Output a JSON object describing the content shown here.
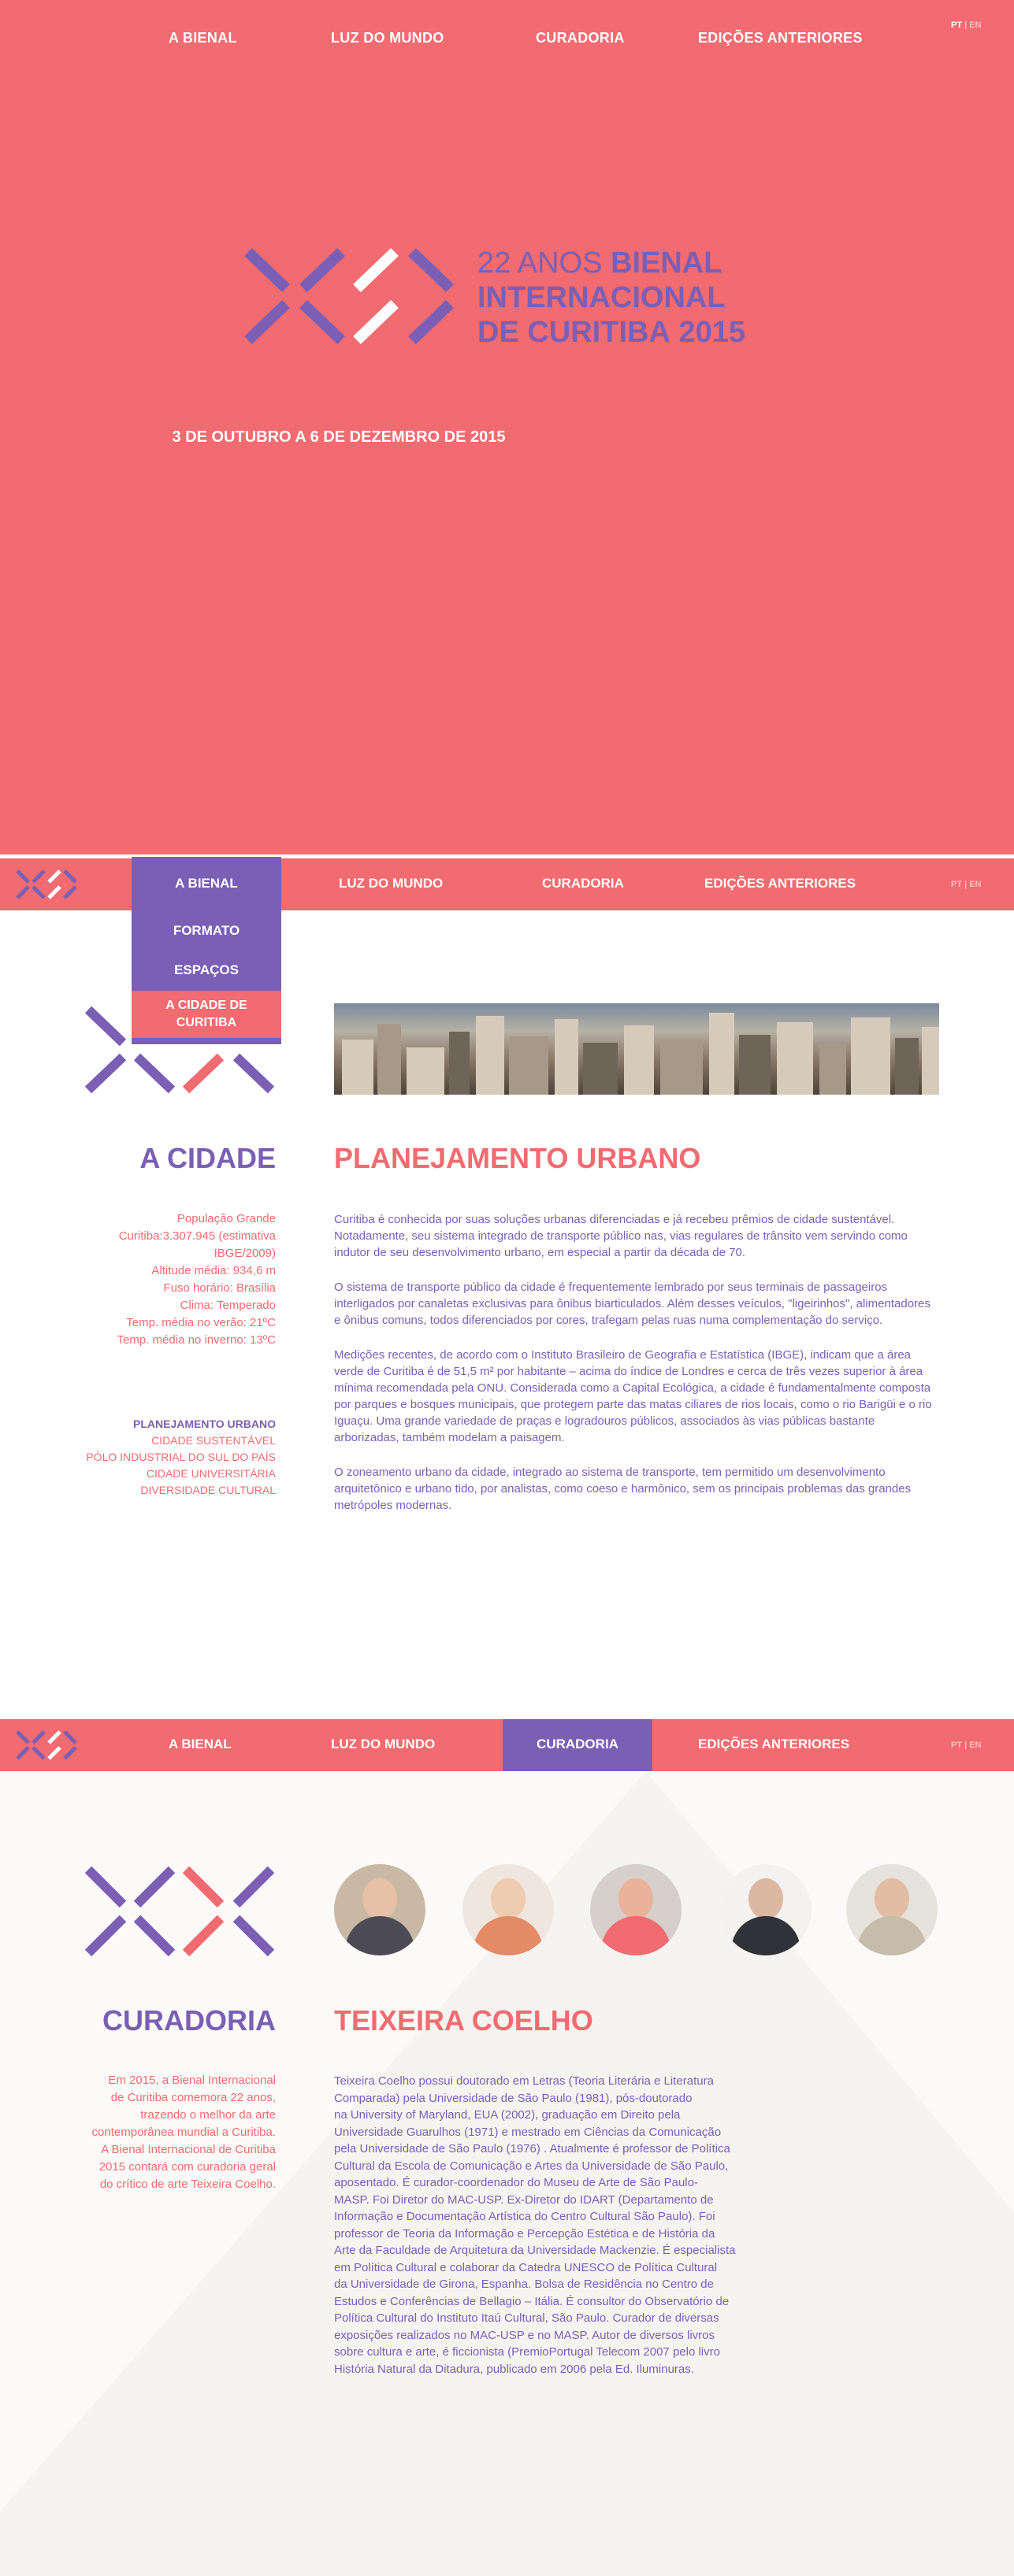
{
  "colors": {
    "coral": "#f16b70",
    "purple": "#7a5fb4",
    "white": "#ffffff"
  },
  "nav": {
    "items": [
      "A BIENAL",
      "LUZ DO MUNDO",
      "CURADORIA",
      "EDIÇÕES ANTERIORES"
    ],
    "lang_pt": "PT",
    "lang_sep": "|",
    "lang_en": "EN"
  },
  "hero": {
    "title_line1_light": "22 ANOS",
    "title_line1_bold": "BIENAL",
    "title_line2": "INTERNACIONAL",
    "title_line3_light": "DE CURITIBA",
    "title_line3_bold": "2015",
    "date": "3 DE OUTUBRO A 6 DE DEZEMBRO DE 2015"
  },
  "section_city": {
    "dropdown": [
      "FORMATO",
      "ESPAÇOS",
      "A CIDADE DE CURITIBA"
    ],
    "dropdown_active_line1": "A CIDADE DE",
    "dropdown_active_line2": "CURITIBA",
    "left_title": "A CIDADE",
    "facts": [
      "População Grande",
      "Curitiba:3.307.945 (estimativa",
      "IBGE/2009)",
      "Altitude média: 934,6 m",
      "Fuso horário: Brasília",
      "Clima: Temperado",
      "Temp. média no verão: 21ºC",
      "Temp. média no inverno: 13ºC"
    ],
    "subnav_title": "PLANEJAMENTO URBANO",
    "subnav": [
      "CIDADE SUSTENTÁVEL",
      "PÓLO INDUSTRIAL DO SUL DO PAÍS",
      "CIDADE UNIVERSITÁRIA",
      "DIVERSIDADE CULTURAL"
    ],
    "main_title": "PLANEJAMENTO URBANO",
    "paragraphs": [
      "Curitiba é conhecida por suas soluções urbanas diferenciadas e já recebeu prêmios de cidade sustentável. Notadamente, seu sistema integrado de transporte público nas, vias regulares de trânsito vem servindo como indutor de seu desenvolvimento urbano, em especial a partir da década de 70.",
      "O sistema de transporte público da cidade é frequentemente lembrado por seus terminais de passageiros interligados por canaletas exclusivas para ônibus biarticulados. Além desses veículos, \"ligeirinhos\", alimentadores e ônibus comuns, todos diferenciados por cores, trafegam pelas ruas numa complementação do serviço.",
      "Medições recentes, de acordo com o Instituto Brasileiro de Geografia e Estatística (IBGE), indicam que a área verde de Curitiba é de 51,5 m² por habitante – acima do índice de Londres e cerca de três vezes superior à área mínima recomendada pela ONU. Considerada como a Capital Ecológica, a cidade é fundamentalmente composta por parques e bosques municipais, que protegem parte das matas ciliares de rios locais, como o rio Barigüi e o rio Iguaçu. Uma grande variedade de praças e logradouros públicos, associados às vias públicas bastante arborizadas, também modelam a paisagem.",
      "O zoneamento urbano da cidade, integrado ao sistema de transporte, tem permitido um desenvolvimento arquitetônico e urbano tido, por analistas, como coeso e harmônico, sem os principais problemas das grandes metrópoles modernas."
    ]
  },
  "section_curadoria": {
    "left_title": "CURADORIA",
    "intro": [
      "Em 2015, a Bienal Internacional",
      "de Curitiba comemora 22 anos,",
      "trazendo o melhor da arte",
      "contemporânea mundial a Curitiba.",
      "A Bienal Internacional de Curitiba",
      "2015 contará com curadoria geral",
      "do crítico de arte Teixeira Coelho."
    ],
    "curator_name": "TEIXEIRA COELHO",
    "bio": [
      "Teixeira Coelho possui doutorado em Letras (Teoria Literária e Literatura",
      "Comparada) pela Universidade de São Paulo (1981), pós-doutorado",
      "na University of Maryland, EUA (2002),  graduação em Direito pela",
      "Universidade Guarulhos (1971) e mestrado em Ciências da Comunicação",
      "pela Universidade de São Paulo (1976) . Atualmente é professor de Política",
      "Cultural da Escola de Comunicação e Artes da Universidade de São Paulo,",
      "aposentado. É curador-coordenador do Museu de Arte de São Paulo-",
      "MASP. Foi Diretor do MAC-USP. Ex-Diretor do IDART (Departamento de",
      "Informação e Documentação Artística do Centro Cultural São Paulo). Foi",
      "professor de Teoria da Informação e Percepção Estética e de História da",
      "Arte da Faculdade de Arquitetura da Universidade Mackenzie. É especialista",
      "em Política Cultural e colaborar da Catedra UNESCO de Política Cultural",
      "da Universidade de Girona, Espanha. Bolsa de Residência no Centro de",
      "Estudos e Conferências de Bellagio – Itália. É consultor do Observatório de",
      "Política Cultural do Instituto Itaú Cultural, São Paulo. Curador de diversas",
      "exposições realizados no MAC-USP e no MASP. Autor de diversos livros",
      "sobre cultura e arte, é ficcionista (PremioPortugal Telecom 2007 pelo livro",
      "História Natural da Ditadura, publicado em 2006 pela Ed. Iluminuras."
    ]
  }
}
